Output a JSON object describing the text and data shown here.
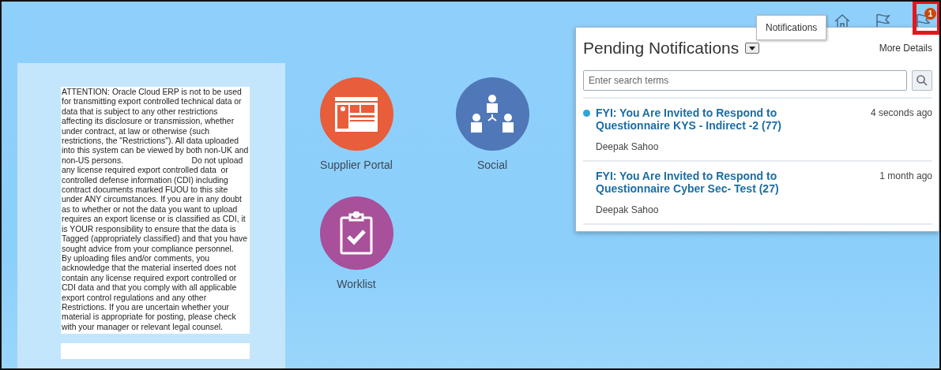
{
  "header_icons": [
    {
      "kind": "home"
    },
    {
      "kind": "flag"
    },
    {
      "kind": "notifications",
      "badge": "1",
      "highlighted": true
    }
  ],
  "tooltip": "Notifications",
  "warning_text": "ATTENTION: Oracle Cloud ERP is not to be used for transmitting export controlled technical data or data that is subject to any other restrictions affecting its disclosure or transmission, whether under contract, at law or otherwise (such restrictions, the \"Restrictions\"). All data uploaded into this system can be viewed by both non-UK and non-US persons.                              Do not upload any license required export controlled data  or controlled defense information (CDI) including contract documents marked FUOU to this site under ANY circumstances. If you are in any doubt as to whether or not the data you want to upload requires an export license or is classified as CDI, it is YOUR responsibility to ensure that the data is Tagged (appropriately classified) and that you have sought advice from your compliance personnel.                                                                          By uploading files and/or comments, you acknowledge that the material inserted does not contain any license required export controlled or CDI data and that you comply with all applicable export control regulations and any other Restrictions. If you are uncertain whether your material is appropriate for posting, please check with your manager or relevant legal counsel.",
  "apps": [
    {
      "label": "Supplier Portal",
      "kind": "portal",
      "color": "#e85d3a"
    },
    {
      "label": "Social",
      "kind": "social",
      "color": "#5077b8"
    },
    {
      "label": "Worklist",
      "kind": "worklist",
      "color": "#a8509a"
    }
  ],
  "notifications": {
    "title": "Pending Notifications",
    "more": "More Details",
    "search": {
      "placeholder": "Enter search terms"
    },
    "items": [
      {
        "title": "FYI: You Are Invited to Respond to Questionnaire KYS - Indirect -2 (77)",
        "time": "4 seconds ago",
        "from": "Deepak Sahoo",
        "unread": true
      },
      {
        "title": "FYI: You Are Invited to Respond to Questionnaire Cyber Sec- Test (27)",
        "time": "1 month ago",
        "from": "Deepak Sahoo",
        "unread": false
      }
    ]
  }
}
